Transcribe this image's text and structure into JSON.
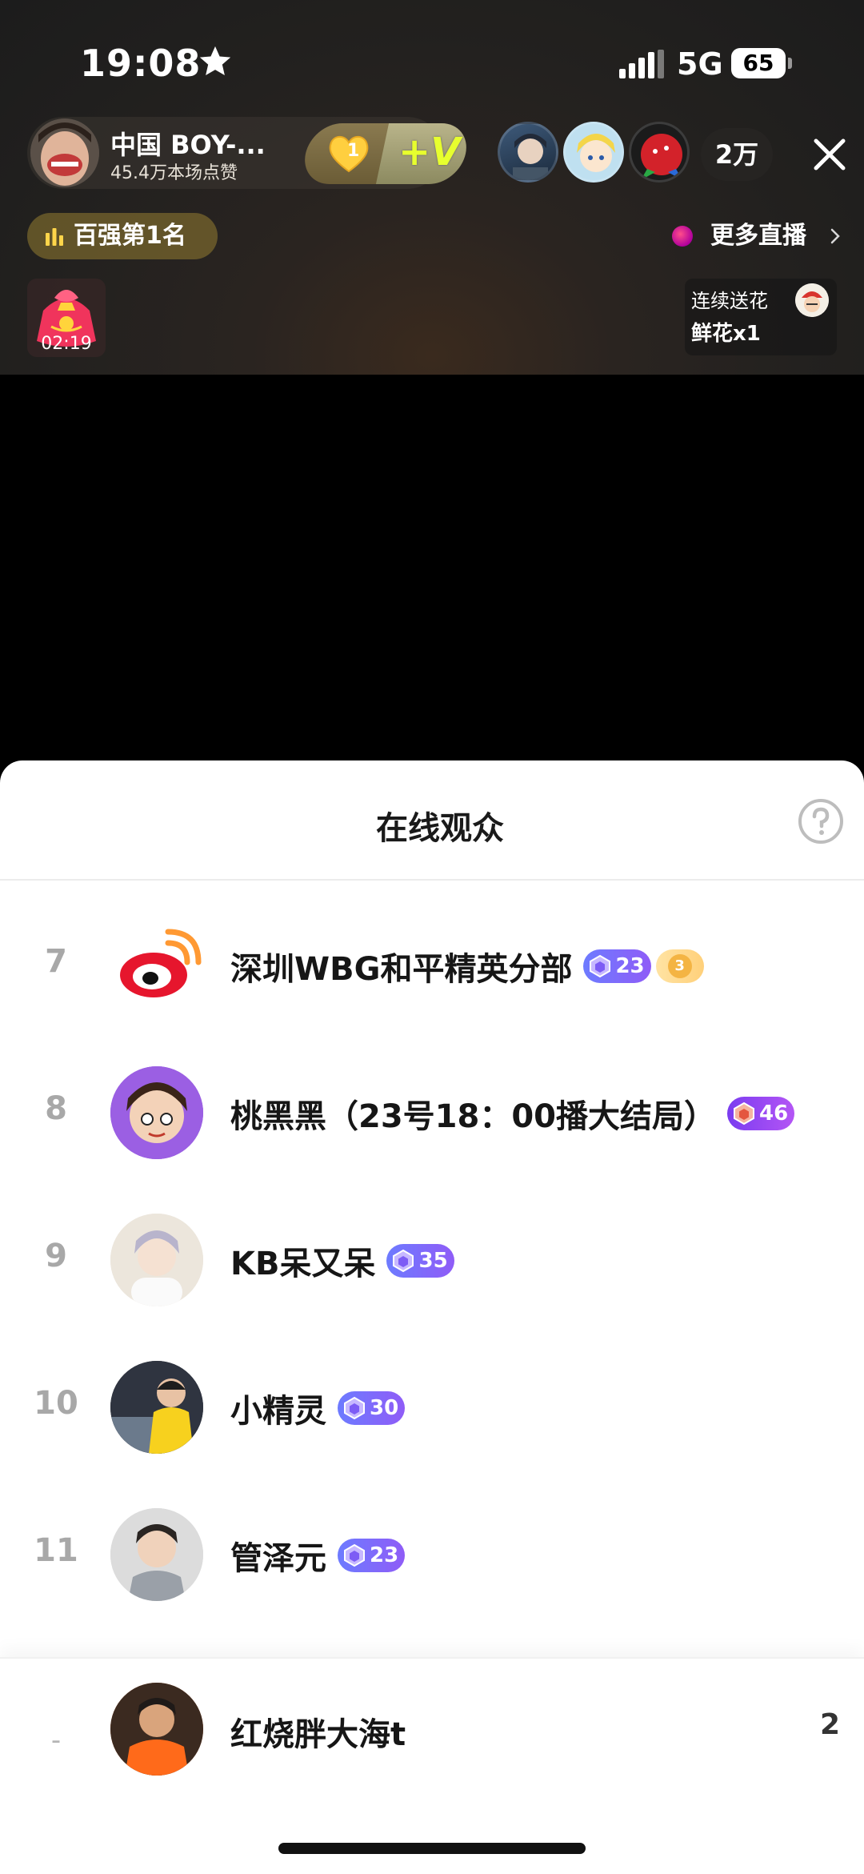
{
  "status_bar": {
    "time": "19:08",
    "network": "5G",
    "battery": "65"
  },
  "host": {
    "name": "中国 BOY-...",
    "likes": "45.4万本场点赞",
    "fan_level": "1",
    "plus_label": "+V"
  },
  "viewers": {
    "count": "2万"
  },
  "rank_badge": {
    "label": "百强第1名"
  },
  "more_live": {
    "label": "更多直播"
  },
  "gift": {
    "timer": "02:19"
  },
  "flower_card": {
    "title": "连续送花",
    "count": "鲜花x1"
  },
  "audience": {
    "title": "在线观众",
    "rows": [
      {
        "rank": "7",
        "name": "深圳WBG和平精英分部",
        "level": "23",
        "gold": "3"
      },
      {
        "rank": "8",
        "name": "桃黑黑（23号18：00播大结局）",
        "level": "46"
      },
      {
        "rank": "9",
        "name": "KB呆又呆",
        "level": "35"
      },
      {
        "rank": "10",
        "name": "小精灵",
        "level": "30"
      },
      {
        "rank": "11",
        "name": "管泽元",
        "level": "23"
      }
    ],
    "me": {
      "rank": "-",
      "name": "红烧胖大海t",
      "score": "2"
    }
  },
  "icons": [
    "star-icon",
    "signal-icon",
    "battery-icon",
    "close-icon",
    "bar-chart-icon",
    "chevron-right-icon",
    "help-icon",
    "level-gem-icon",
    "gold-coin-icon"
  ]
}
